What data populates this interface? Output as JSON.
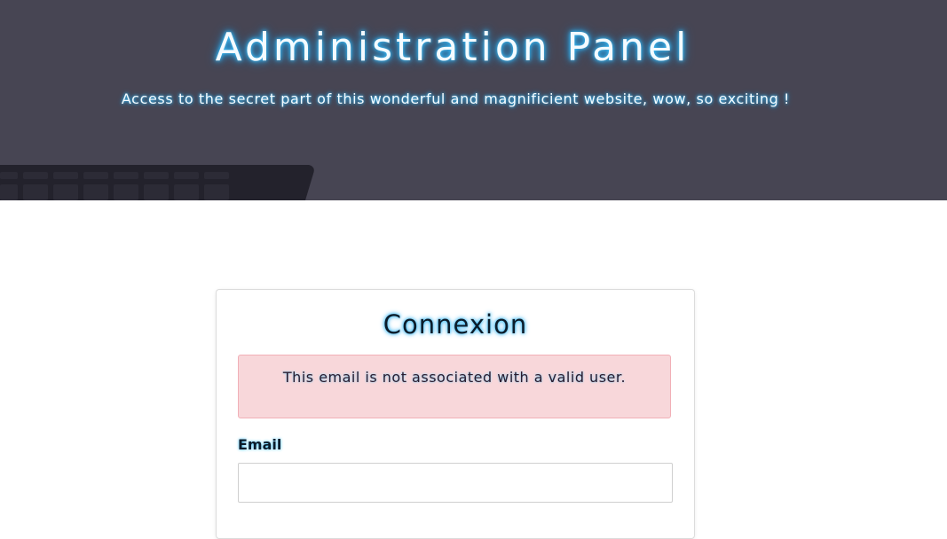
{
  "header": {
    "title": "Administration Panel",
    "subtitle": "Access to the secret part of this wonderful and magnificient website, wow, so exciting !",
    "background_color": "#474553",
    "glow_color": "#3ec6ff"
  },
  "login_card": {
    "title": "Connexion",
    "alert": {
      "message": "This email is not associated with a valid user.",
      "background_color": "#f8d7da"
    },
    "email_field": {
      "label": "Email",
      "value": "",
      "placeholder": ""
    }
  }
}
